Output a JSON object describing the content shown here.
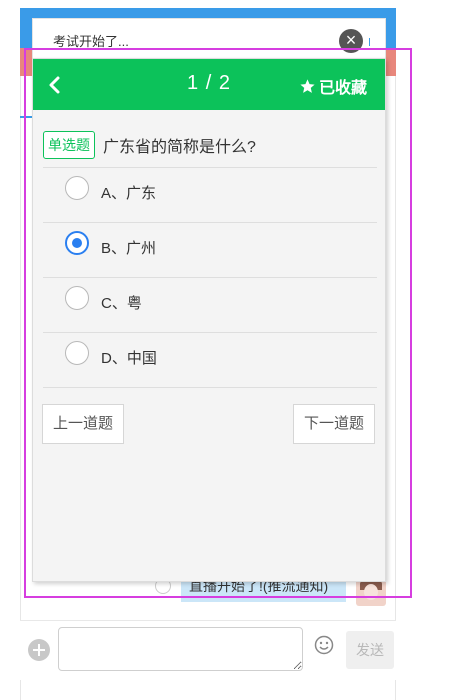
{
  "notice": {
    "text": "考试开始了...",
    "close_icon": "close-icon"
  },
  "quiz": {
    "header": {
      "back_icon": "chevron-left-icon",
      "counter": "1 / 2",
      "favorite_label": "已收藏",
      "favorite_icon": "star-icon"
    },
    "question": {
      "type_tag": "单选题",
      "text": "广东省的简称是什么?"
    },
    "options": [
      {
        "label": "A、广东",
        "selected": false
      },
      {
        "label": "B、广州",
        "selected": true
      },
      {
        "label": "C、粤",
        "selected": false
      },
      {
        "label": "D、中国",
        "selected": false
      }
    ],
    "prev_label": "上一道题",
    "next_label": "下一道题"
  },
  "background_chat": {
    "message": "直播开始了!(推流通知)"
  },
  "input_bar": {
    "placeholder": "",
    "send_label": "发送",
    "add_icon": "plus-icon",
    "emoji_icon": "emoji-icon"
  },
  "colors": {
    "accent_green": "#0cc25a",
    "radio_blue": "#2a7ff0",
    "highlight": "#d63ee0"
  }
}
